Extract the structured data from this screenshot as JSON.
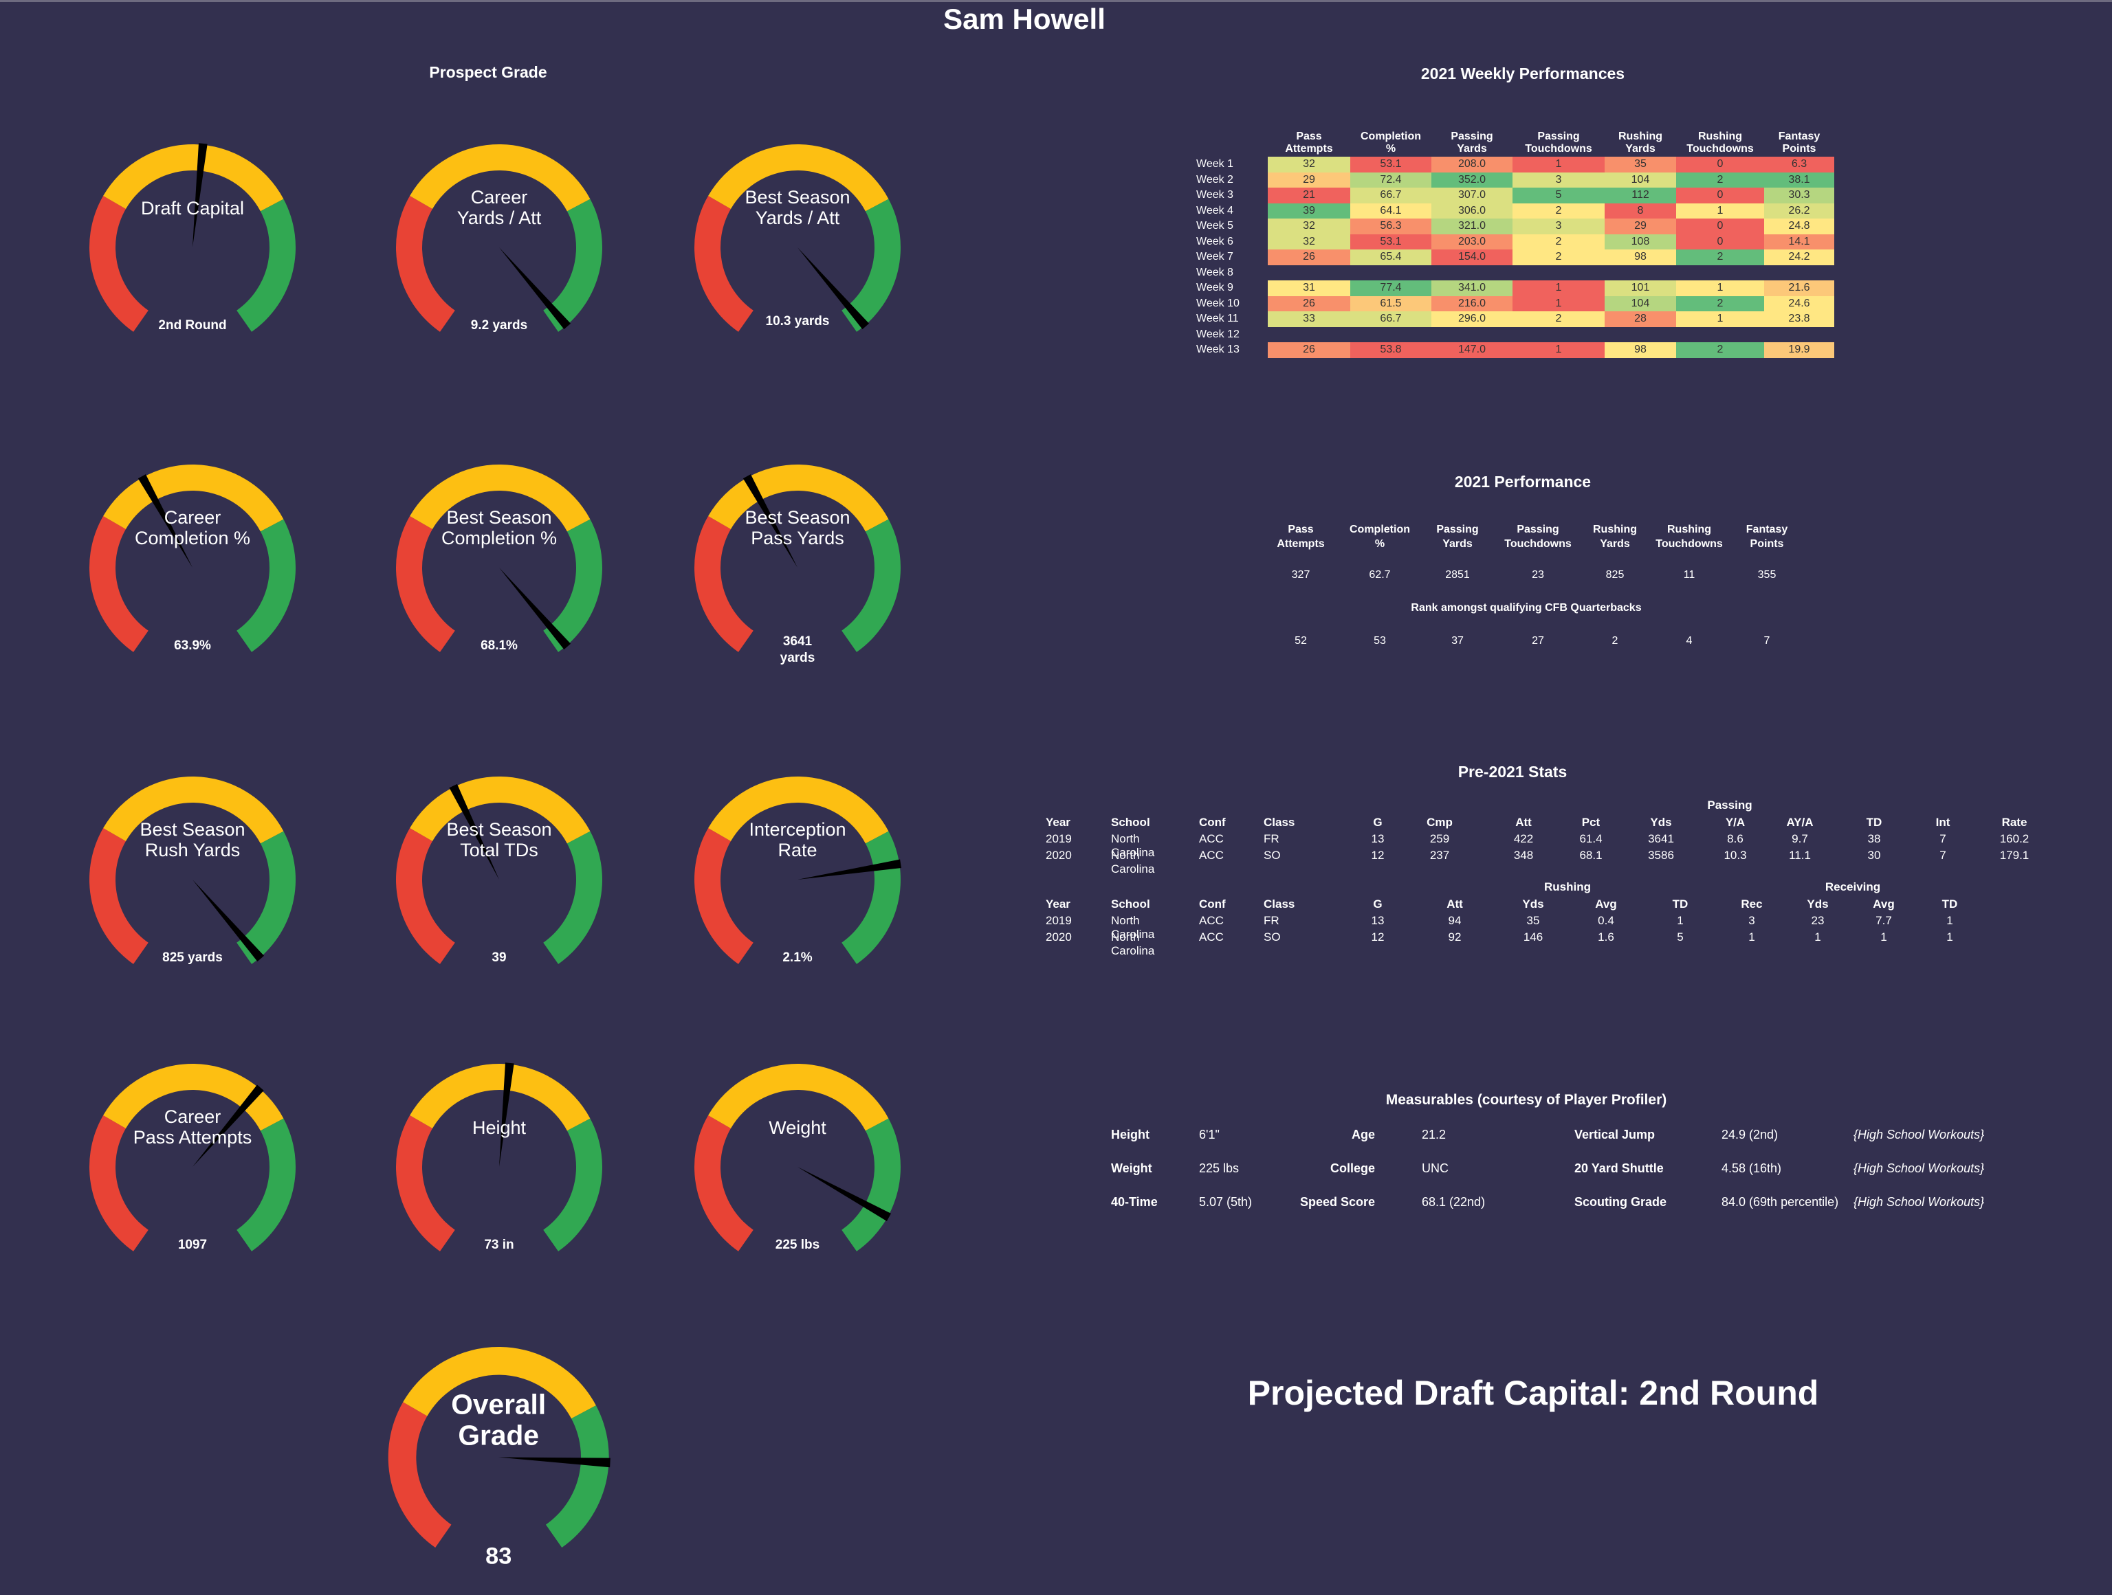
{
  "page_title": "Sam Howell",
  "colors": {
    "background": "#33304f",
    "red": "#e84335",
    "yellow": "#fdbf12",
    "green": "#31a852",
    "needle": "#000000",
    "heat_red": "#f0625d",
    "heat_orange": "#f8906b",
    "heat_lightorange": "#fcc879",
    "heat_yellow": "#ffe783",
    "heat_yellowgreen": "#dbe081",
    "heat_lightgreen": "#b5d680",
    "heat_green": "#63bd7b"
  },
  "prospect_grade": {
    "title": "Prospect Grade",
    "gauges": [
      {
        "label": [
          "Draft Capital"
        ],
        "value": "2nd Round",
        "fraction": 0.52
      },
      {
        "label": [
          "Career",
          "Yards / Att"
        ],
        "value": "9.2 yards",
        "fraction": 0.98
      },
      {
        "label": [
          "Best Season",
          "Yards / Att"
        ],
        "value": "10.3 yards",
        "fraction": 0.98
      },
      {
        "label": [
          "Career",
          "Completion %"
        ],
        "value": "63.9%",
        "fraction": 0.4
      },
      {
        "label": [
          "Best Season",
          "Completion %"
        ],
        "value": "68.1%",
        "fraction": 0.98
      },
      {
        "label": [
          "Best Season",
          "Pass Yards"
        ],
        "value": "3641 yards",
        "fraction": 0.4
      },
      {
        "label": [
          "Best Season",
          "Rush Yards"
        ],
        "value": "825 yards",
        "fraction": 0.98
      },
      {
        "label": [
          "Best Season",
          "Total TDs"
        ],
        "value": "39",
        "fraction": 0.41
      },
      {
        "label": [
          "Interception",
          "Rate"
        ],
        "value": "2.1%",
        "fraction": 0.78
      },
      {
        "label": [
          "Career",
          "Pass Attempts"
        ],
        "value": "1097",
        "fraction": 0.64
      },
      {
        "label": [
          "Height"
        ],
        "value": "73 in",
        "fraction": 0.52
      },
      {
        "label": [
          "Weight"
        ],
        "value": "225 lbs",
        "fraction": 0.91
      }
    ],
    "overall": {
      "label": [
        "Overall",
        "Grade"
      ],
      "value": "83",
      "fraction": 0.82
    }
  },
  "weekly": {
    "title": "2021 Weekly Performances",
    "columns": [
      [
        "Pass",
        "Attempts"
      ],
      [
        "Completion",
        "%"
      ],
      [
        "Passing",
        "Yards"
      ],
      [
        "Passing",
        "Touchdowns"
      ],
      [
        "Rushing",
        "Yards"
      ],
      [
        "Rushing",
        "Touchdowns"
      ],
      [
        "Fantasy",
        "Points"
      ]
    ],
    "rows": [
      {
        "week": "Week 1",
        "values": [
          "32",
          "53.1",
          "208.0",
          "1",
          "35",
          "0",
          "6.3"
        ],
        "heat": [
          "yellowgreen",
          "red",
          "orange",
          "red",
          "orange",
          "red",
          "red"
        ]
      },
      {
        "week": "Week 2",
        "values": [
          "29",
          "72.4",
          "352.0",
          "3",
          "104",
          "2",
          "38.1"
        ],
        "heat": [
          "lightorange",
          "lightgreen",
          "green",
          "yellowgreen",
          "yellowgreen",
          "green",
          "green"
        ]
      },
      {
        "week": "Week 3",
        "values": [
          "21",
          "66.7",
          "307.0",
          "5",
          "112",
          "0",
          "30.3"
        ],
        "heat": [
          "red",
          "yellowgreen",
          "yellowgreen",
          "green",
          "green",
          "red",
          "lightgreen"
        ]
      },
      {
        "week": "Week 4",
        "values": [
          "39",
          "64.1",
          "306.0",
          "2",
          "8",
          "1",
          "26.2"
        ],
        "heat": [
          "green",
          "yellow",
          "yellowgreen",
          "yellow",
          "red",
          "yellow",
          "yellowgreen"
        ]
      },
      {
        "week": "Week 5",
        "values": [
          "32",
          "56.3",
          "321.0",
          "3",
          "29",
          "0",
          "24.8"
        ],
        "heat": [
          "yellowgreen",
          "orange",
          "lightgreen",
          "yellowgreen",
          "orange",
          "red",
          "yellow"
        ]
      },
      {
        "week": "Week 6",
        "values": [
          "32",
          "53.1",
          "203.0",
          "2",
          "108",
          "0",
          "14.1"
        ],
        "heat": [
          "yellowgreen",
          "red",
          "orange",
          "yellow",
          "lightgreen",
          "red",
          "orange"
        ]
      },
      {
        "week": "Week 7",
        "values": [
          "26",
          "65.4",
          "154.0",
          "2",
          "98",
          "2",
          "24.2"
        ],
        "heat": [
          "orange",
          "yellowgreen",
          "red",
          "yellow",
          "yellow",
          "green",
          "yellow"
        ]
      },
      {
        "week": "Week 8",
        "values": [],
        "heat": []
      },
      {
        "week": "Week 9",
        "values": [
          "31",
          "77.4",
          "341.0",
          "1",
          "101",
          "1",
          "21.6"
        ],
        "heat": [
          "yellow",
          "green",
          "lightgreen",
          "red",
          "yellowgreen",
          "yellow",
          "lightorange"
        ]
      },
      {
        "week": "Week 10",
        "values": [
          "26",
          "61.5",
          "216.0",
          "1",
          "104",
          "2",
          "24.6"
        ],
        "heat": [
          "orange",
          "lightorange",
          "orange",
          "red",
          "lightgreen",
          "green",
          "yellow"
        ]
      },
      {
        "week": "Week 11",
        "values": [
          "33",
          "66.7",
          "296.0",
          "2",
          "28",
          "1",
          "23.8"
        ],
        "heat": [
          "yellowgreen",
          "yellowgreen",
          "yellow",
          "yellow",
          "orange",
          "yellow",
          "yellow"
        ]
      },
      {
        "week": "Week 12",
        "values": [],
        "heat": []
      },
      {
        "week": "Week 13",
        "values": [
          "26",
          "53.8",
          "147.0",
          "1",
          "98",
          "2",
          "19.9"
        ],
        "heat": [
          "orange",
          "red",
          "red",
          "red",
          "yellow",
          "green",
          "lightorange"
        ]
      }
    ]
  },
  "performance_2021": {
    "title": "2021 Performance",
    "columns": [
      [
        "Pass",
        "Attempts"
      ],
      [
        "Completion",
        "%"
      ],
      [
        "Passing",
        "Yards"
      ],
      [
        "Passing",
        "Touchdowns"
      ],
      [
        "Rushing",
        "Yards"
      ],
      [
        "Rushing",
        "Touchdowns"
      ],
      [
        "Fantasy",
        "Points"
      ]
    ],
    "totals": [
      "327",
      "62.7",
      "2851",
      "23",
      "825",
      "11",
      "355"
    ],
    "rank_title": "Rank amongst qualifying CFB Quarterbacks",
    "ranks": [
      "52",
      "53",
      "37",
      "27",
      "2",
      "4",
      "7"
    ]
  },
  "pre2021": {
    "title": "Pre-2021 Stats",
    "passing_group": "Passing",
    "passing_headers": [
      "Year",
      "School",
      "Conf",
      "Class",
      "G",
      "Cmp",
      "Att",
      "Pct",
      "Yds",
      "Y/A",
      "AY/A",
      "TD",
      "Int",
      "Rate"
    ],
    "passing_rows": [
      [
        "2019",
        "North Carolina",
        "ACC",
        "FR",
        "13",
        "259",
        "422",
        "61.4",
        "3641",
        "8.6",
        "9.7",
        "38",
        "7",
        "160.2"
      ],
      [
        "2020",
        "North Carolina",
        "ACC",
        "SO",
        "12",
        "237",
        "348",
        "68.1",
        "3586",
        "10.3",
        "11.1",
        "30",
        "7",
        "179.1"
      ]
    ],
    "rushing_group": "Rushing",
    "receiving_group": "Receiving",
    "rr_headers": [
      "Year",
      "School",
      "Conf",
      "Class",
      "G",
      "Att",
      "Yds",
      "Avg",
      "TD",
      "Rec",
      "Yds",
      "Avg",
      "TD"
    ],
    "rr_rows": [
      [
        "2019",
        "North Carolina",
        "ACC",
        "FR",
        "13",
        "94",
        "35",
        "0.4",
        "1",
        "3",
        "23",
        "7.7",
        "1"
      ],
      [
        "2020",
        "North Carolina",
        "ACC",
        "SO",
        "12",
        "92",
        "146",
        "1.6",
        "5",
        "1",
        "1",
        "1",
        "1"
      ]
    ]
  },
  "measurables": {
    "title": "Measurables (courtesy of Player Profiler)",
    "rows": [
      {
        "l1": "Height",
        "v1": "6'1\"",
        "l2": "Age",
        "v2": "21.2",
        "l3": "Vertical Jump",
        "v3": "24.9 (2nd)",
        "note": "{High School Workouts}"
      },
      {
        "l1": "Weight",
        "v1": "225 lbs",
        "l2": "College",
        "v2": "UNC",
        "l3": "20 Yard Shuttle",
        "v3": "4.58 (16th)",
        "note": "{High School Workouts}"
      },
      {
        "l1": "40-Time",
        "v1": "5.07 (5th)",
        "l2": "Speed Score",
        "v2": "68.1 (22nd)",
        "l3": "Scouting Grade",
        "v3": "84.0 (69th percentile)",
        "note": "{High School Workouts}"
      }
    ]
  },
  "projected": "Projected Draft Capital: 2nd Round"
}
